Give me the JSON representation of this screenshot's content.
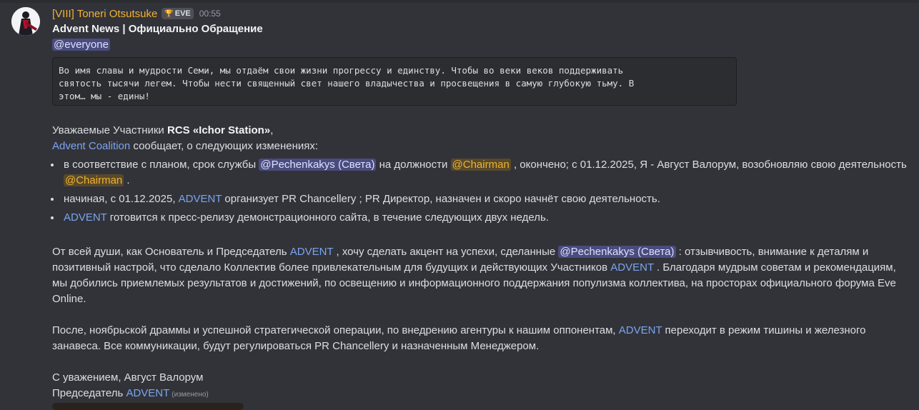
{
  "author": {
    "name": "[VIII] Toneri Otsutsuke",
    "tag": "EVE",
    "timestamp": "00:55"
  },
  "title": "Advent News | Официально Обращение",
  "everyone": "@everyone",
  "code_lines": [
    "Во имя славы и мудрости Семи, мы отдаём свои жизни прогрессу и единству. Чтобы во веки веков поддерживать",
    "святость тысячи легем. Чтобы нести священный свет нашего владычества и просвещения в самую глубокую тьму. В",
    "этом… мы - едины!"
  ],
  "greeting": {
    "prefix": "Уважаемые Участники ",
    "bold": "RCS «Ichor Station»",
    "suffix": ","
  },
  "coalition": {
    "link": "Advent Coalition",
    "text": " сообщает, о следующих изменениях:"
  },
  "bullets": {
    "b1_a": "в соответствие с планом, срок службы ",
    "b1_mention1": "@Pechenkakys (Света)",
    "b1_b": " на должности ",
    "b1_mention2": "@Chairman",
    "b1_c": " , окончено; с 01.12.2025, Я - Август Валорум, возобновляю свою деятельность",
    "b1_mention3": "@Chairman",
    "b1_d": " .",
    "b2_a": "начиная, с 01.12.2025, ",
    "b2_link": "ADVENT",
    "b2_b": " организует PR Chancellery ; PR Директор, назначен и скоро начнёт свою деятельность.",
    "b3_link": "ADVENT",
    "b3_a": " готовится к пресс-релизу демонстрационного сайта, в течение следующих двух недель."
  },
  "para1": {
    "a": "От всей души, как Основатель и Председатель ",
    "link1": "ADVENT",
    "b": " , хочу сделать акцент на успехи, сделанные ",
    "mention": "@Pechenkakys (Света)",
    "c": " : отзывчивость, внимание к деталям и",
    "line2_a": "позитивный настрой, что сделало Коллектив более привлекательным для будущих и действующих Участников ",
    "link2": "ADVENT",
    "line2_b": " . Благодаря мудрым советам и рекомендациям,",
    "line3": "мы добились приемлемых результатов и достижений, по освещению и информационного поддержания популизма коллектива, на просторах официального форума Eve",
    "line4": "Online."
  },
  "para2": {
    "a": "После, ноябрьской драммы и успешной стратегической операции, по внедрению агентуры к нашим оппонентам, ",
    "link": "ADVENT",
    "b": " переходит в режим тишины и железного",
    "line2": "занавеса. Все коммуникации, будут регулироваться PR Chancellery и назначенным Менеджером."
  },
  "signoff": {
    "line1": "С уважением, Август Валорум",
    "line2_a": "Председатель ",
    "link": "ADVENT",
    "edited": "(изменено)"
  },
  "colors": {
    "background": "#323339",
    "username": "#f0b232",
    "link": "#7aa5f0",
    "mention_blue_bg": "#4a4c7f",
    "mention_yellow_bg": "#57492b"
  }
}
